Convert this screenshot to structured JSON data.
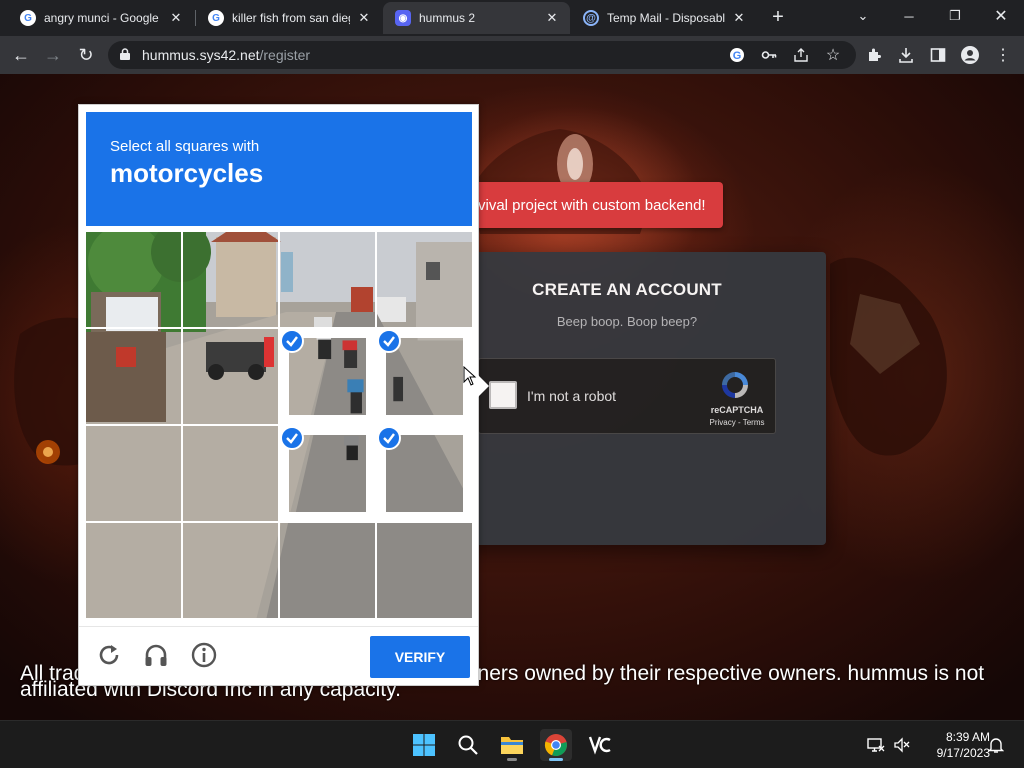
{
  "browser": {
    "tabs": [
      {
        "title": "angry munci - Google S",
        "favicon": "google-icon"
      },
      {
        "title": "killer fish from san dieg",
        "favicon": "google-icon"
      },
      {
        "title": "hummus 2",
        "favicon": "discord-icon",
        "active": true
      },
      {
        "title": "Temp Mail - Disposable",
        "favicon": "tempmail-icon"
      }
    ],
    "new_tab": "+",
    "url_host": "hummus.sys42.net",
    "url_path": "/register"
  },
  "page": {
    "toast": "vival project with custom backend!",
    "card": {
      "title": "CREATE AN ACCOUNT",
      "subtitle": "Beep boop. Boop beep?"
    },
    "recaptcha": {
      "label": "I'm not a robot",
      "brand": "reCAPTCHA",
      "privacy": "Privacy",
      "sep": " - ",
      "terms": "Terms"
    },
    "footer_line1": "All trademarks are property of their respective owners owned by their respective owners. hummus is not",
    "footer_line2": "affiliated with Discord Inc in any capacity."
  },
  "captcha": {
    "instruction": "Select all squares with",
    "target": "motorcycles",
    "verify_label": "VERIFY",
    "selected_tiles": [
      6,
      7,
      10,
      11
    ]
  },
  "taskbar": {
    "time": "8:39 AM",
    "date": "9/17/2023"
  },
  "colors": {
    "accent": "#1a73e8",
    "toast": "#d83c3e",
    "card": "#36393f"
  }
}
